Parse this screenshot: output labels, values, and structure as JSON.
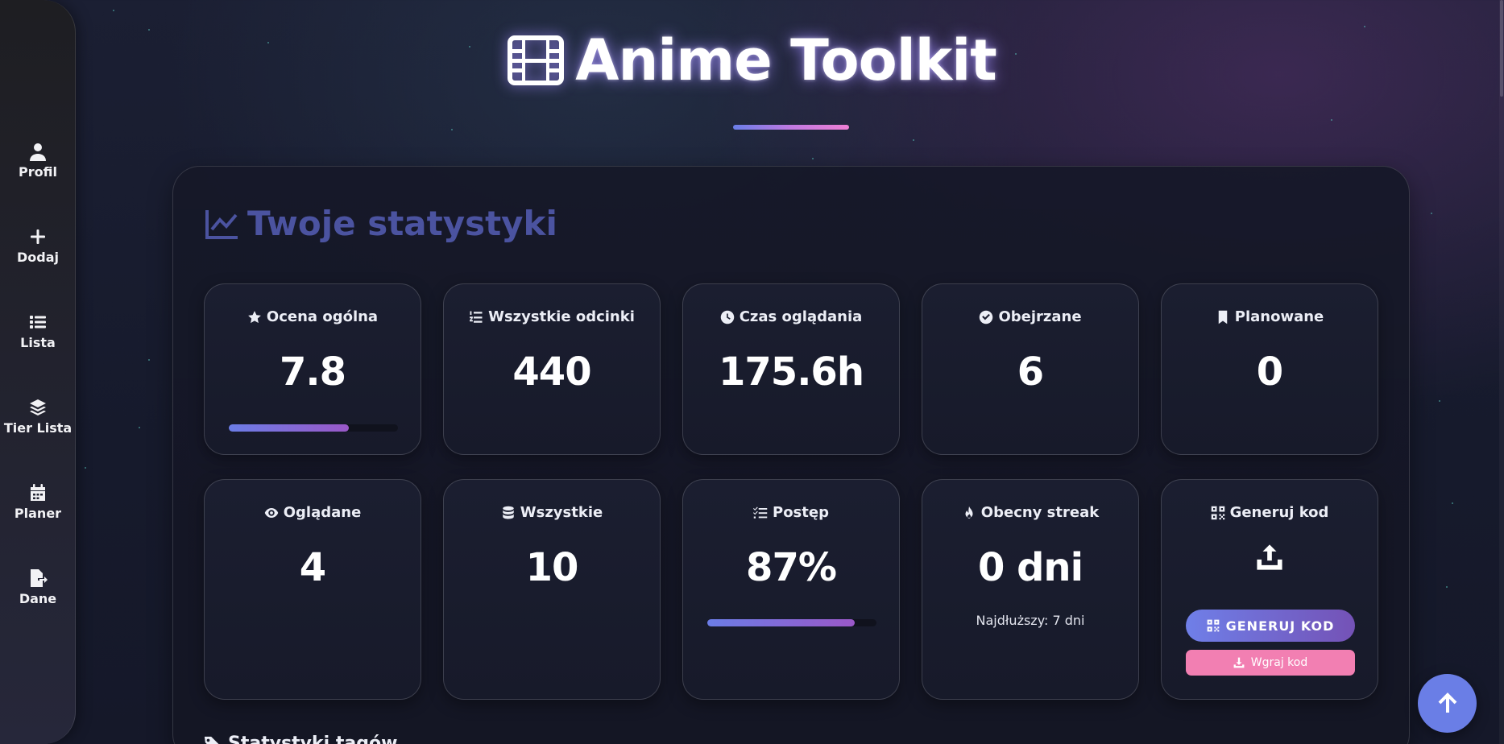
{
  "sidebar": {
    "items": [
      {
        "label": "Profil",
        "icon": "user-icon"
      },
      {
        "label": "Dodaj",
        "icon": "plus-icon"
      },
      {
        "label": "Lista",
        "icon": "list-icon"
      },
      {
        "label": "Tier Lista",
        "icon": "layers-icon"
      },
      {
        "label": "Planer",
        "icon": "calendar-icon"
      },
      {
        "label": "Dane",
        "icon": "file-export-icon"
      }
    ]
  },
  "header": {
    "title": "Anime Toolkit",
    "icon": "film-icon"
  },
  "stats": {
    "title": "Twoje statystyki",
    "cards": [
      {
        "label": "Ocena ogólna",
        "value": "7.8",
        "icon": "star-icon",
        "progress": 0.71
      },
      {
        "label": "Wszystkie odcinki",
        "value": "440",
        "icon": "numbered-list-icon"
      },
      {
        "label": "Czas oglądania",
        "value": "175.6h",
        "icon": "clock-icon"
      },
      {
        "label": "Obejrzane",
        "value": "6",
        "icon": "check-circle-icon"
      },
      {
        "label": "Planowane",
        "value": "0",
        "icon": "bookmark-icon"
      },
      {
        "label": "Oglądane",
        "value": "4",
        "icon": "eye-icon"
      },
      {
        "label": "Wszystkie",
        "value": "10",
        "icon": "database-icon"
      },
      {
        "label": "Postęp",
        "value": "87%",
        "icon": "checklist-icon",
        "progress": 0.87
      },
      {
        "label": "Obecny streak",
        "value": "0 dni",
        "icon": "fire-icon",
        "sub": "Najdłuższy: 7 dni"
      },
      {
        "label": "Generuj kod",
        "icon": "qrcode-icon",
        "button_primary": "GENERUJ KOD",
        "button_secondary": "Wgraj kod"
      }
    ]
  },
  "tags_section": {
    "title": "Statystyki tagów",
    "icon": "tags-icon"
  },
  "colors": {
    "accent": "#6a7ee6",
    "pink": "#f27fb2",
    "panel_title": "#4b53a0"
  }
}
